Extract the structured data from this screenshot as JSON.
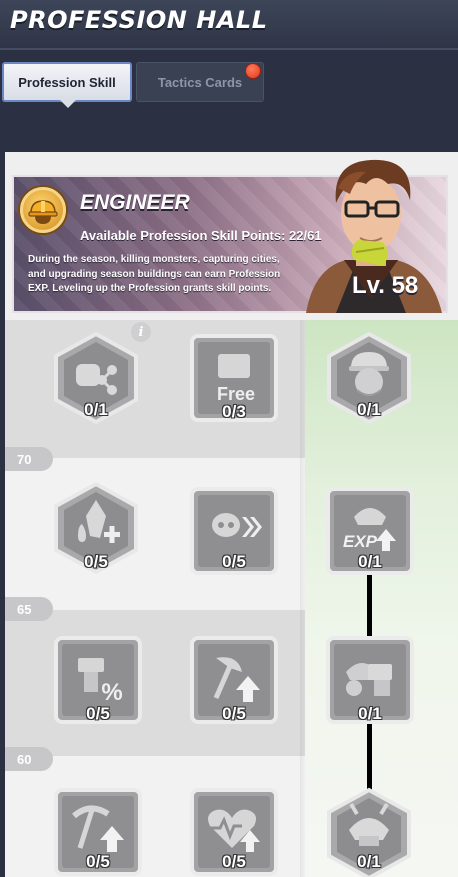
{
  "header": {
    "title": "PROFESSION HALL"
  },
  "tabs": [
    {
      "label": "Profession Skill",
      "active": true
    },
    {
      "label": "Tactics Cards",
      "active": false,
      "notification": true
    }
  ],
  "profession": {
    "name": "ENGINEER",
    "points_text": "Available Profession Skill Points: 22/61",
    "description": "During the season, killing monsters, capturing cities, and upgrading season buildings can earn Profession EXP. Leveling up the Profession grants skill points.",
    "level_text": "Lv. 58"
  },
  "tree": {
    "level_markers": [
      "70",
      "65",
      "60"
    ],
    "rows": [
      {
        "skills": [
          {
            "icon": "fist-share-icon",
            "count": "0/1",
            "shape": "hex"
          },
          {
            "icon": "free-build-icon",
            "count": "0/3",
            "shape": "square"
          },
          {
            "icon": "engineer-portrait-icon",
            "count": "0/1",
            "shape": "hex"
          }
        ]
      },
      {
        "skills": [
          {
            "icon": "crystal-plus-icon",
            "count": "0/5",
            "shape": "hex"
          },
          {
            "icon": "skull-arrows-icon",
            "count": "0/5",
            "shape": "square"
          },
          {
            "icon": "samurai-exp-icon",
            "count": "0/1",
            "shape": "square"
          }
        ]
      },
      {
        "skills": [
          {
            "icon": "build-discount-icon",
            "count": "0/5",
            "shape": "square"
          },
          {
            "icon": "axe-up-icon",
            "count": "0/5",
            "shape": "square"
          },
          {
            "icon": "samurai-build-icon",
            "count": "0/1",
            "shape": "square"
          }
        ]
      },
      {
        "skills": [
          {
            "icon": "pickaxe-up-icon",
            "count": "0/5",
            "shape": "square"
          },
          {
            "icon": "heart-pulse-icon",
            "count": "0/5",
            "shape": "square"
          },
          {
            "icon": "samurai-helmet-icon",
            "count": "0/1",
            "shape": "hex"
          }
        ]
      }
    ]
  },
  "colors": {
    "header_bg": "#2f3547",
    "tab_active_border": "#6b88c4",
    "notification": "#e2381c",
    "right_column_green": "#cde5c2"
  }
}
